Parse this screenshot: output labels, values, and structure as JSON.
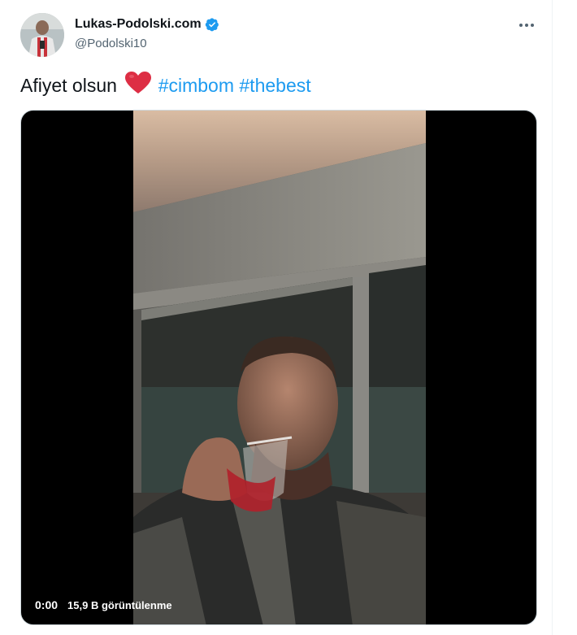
{
  "author": {
    "name": "Lukas-Podolski.com",
    "handle": "@Podolski10",
    "verified": true,
    "avatar_icon": "avatar-photo"
  },
  "menu": {
    "icon": "more-horizontal-icon",
    "label": "•••"
  },
  "tweet": {
    "text": "Afiyet olsun",
    "emoji": "red-heart-icon",
    "hashtags": [
      "#cimbom",
      "#thebest"
    ]
  },
  "video": {
    "time": "0:00",
    "views": "15,9 B görüntülenme"
  },
  "colors": {
    "accent": "#1d9bf0",
    "text": "#0f1419",
    "secondary": "#536471",
    "heart": "#f91880"
  }
}
